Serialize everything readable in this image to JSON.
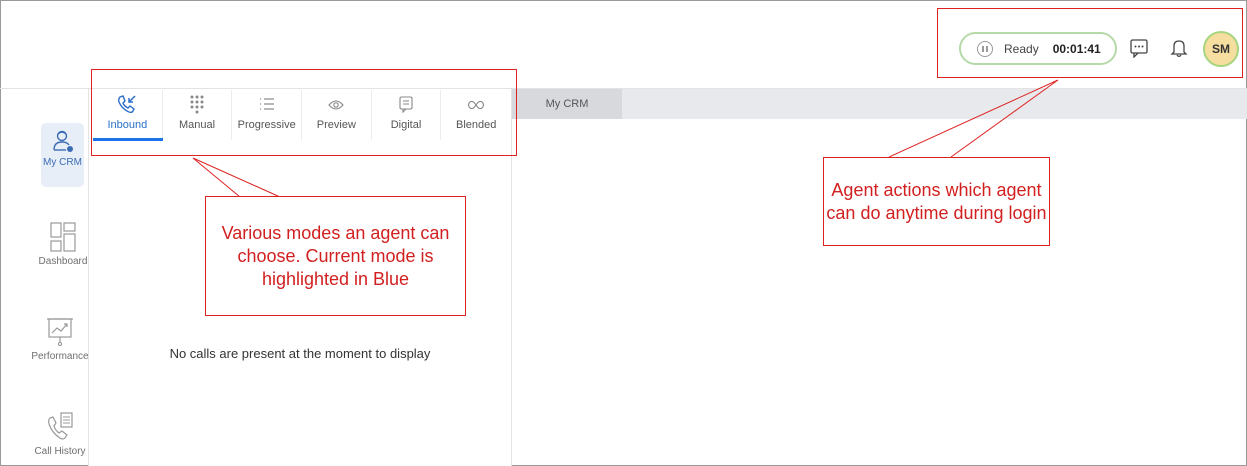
{
  "nav": {
    "items": [
      {
        "label": "My CRM",
        "icon": "agent-icon"
      },
      {
        "label": "Dashboard",
        "icon": "dashboard-icon"
      },
      {
        "label": "Performance",
        "icon": "performance-icon"
      },
      {
        "label": "Call History",
        "icon": "call-history-icon"
      }
    ]
  },
  "modes": [
    {
      "label": "Inbound",
      "icon": "inbound-call-icon",
      "active": true
    },
    {
      "label": "Manual",
      "icon": "dialpad-icon"
    },
    {
      "label": "Progressive",
      "icon": "list-icon"
    },
    {
      "label": "Preview",
      "icon": "eye-icon"
    },
    {
      "label": "Digital",
      "icon": "message-icon"
    },
    {
      "label": "Blended",
      "icon": "infinity-icon"
    }
  ],
  "main": {
    "empty_message": "No calls are present at the moment to display",
    "tab_label": "My CRM"
  },
  "header": {
    "status": "Ready",
    "timer": "00:01:41",
    "avatar_initials": "SM"
  },
  "annotations": {
    "modes_callout": "Various modes an agent can choose. Current mode is highlighted in Blue",
    "actions_callout": "Agent actions which agent can do anytime during login"
  },
  "colors": {
    "accent": "#1a73e8",
    "annotation": "#d22222",
    "ready_border": "#b6d9a8",
    "avatar_bg": "#f6dea0"
  }
}
